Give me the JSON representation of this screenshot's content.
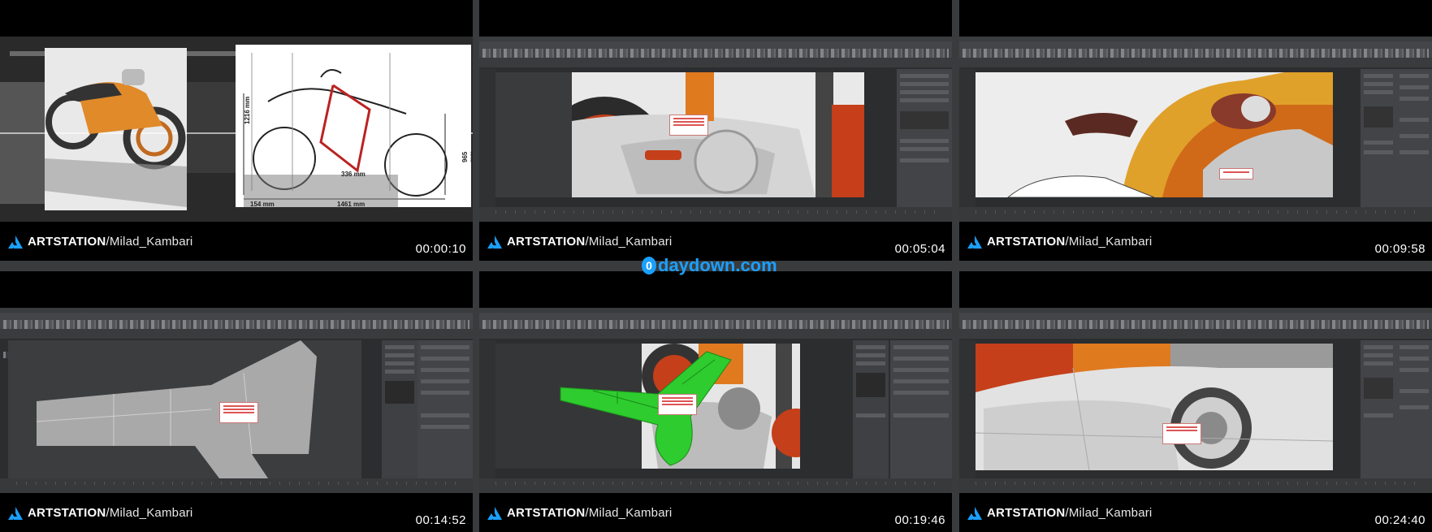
{
  "watermark": {
    "text": "daydown.com",
    "glyph": "0"
  },
  "brand": {
    "bold": "ART",
    "rest_bold": "STATION",
    "path": "/Milad_Kambari"
  },
  "tiles": [
    {
      "timestamp": "00:00:10",
      "dims": {
        "height_a": "1216 mm",
        "height_b": "965 mm",
        "mid": "336 mm",
        "base_left": "154 mm",
        "base_right": "1461 mm"
      }
    },
    {
      "timestamp": "00:05:04"
    },
    {
      "timestamp": "00:09:58"
    },
    {
      "timestamp": "00:14:52"
    },
    {
      "timestamp": "00:19:46"
    },
    {
      "timestamp": "00:24:40"
    }
  ],
  "colors": {
    "brand_blue": "#1aa0ff",
    "accent_orange": "#e07a1f",
    "model_green": "#2ecc2e",
    "dim_red": "#b22"
  }
}
